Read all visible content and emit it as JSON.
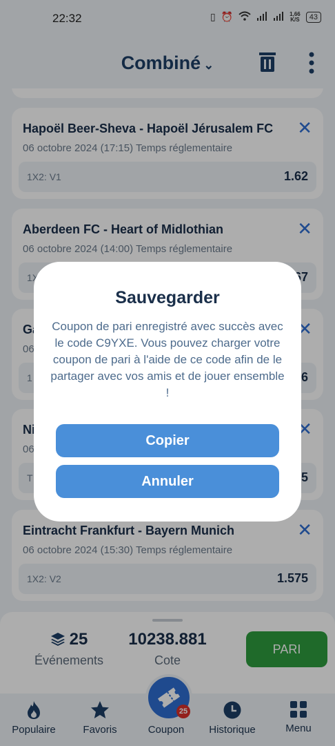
{
  "status_bar": {
    "time": "22:32",
    "speed_value": "1,66",
    "speed_unit": "K/S",
    "battery": "43"
  },
  "header": {
    "title": "Combiné"
  },
  "bets": [
    {
      "match": "Hapoël Beer-Sheva - Hapoël Jérusalem FC",
      "date": "06 octobre 2024 (17:15) Temps réglementaire",
      "selection": "1X2: V1",
      "odd": "1.62"
    },
    {
      "match": "Aberdeen FC - Heart of Midlothian",
      "date": "06 octobre 2024 (14:00) Temps réglementaire",
      "selection": "1X2: V1",
      "odd": "1.67"
    },
    {
      "match": "Ga",
      "date": "06",
      "selection": "1",
      "odd": "6"
    },
    {
      "match": "Ni",
      "date": "06",
      "selection": "T",
      "odd": "5"
    },
    {
      "match": "Eintracht Frankfurt - Bayern Munich",
      "date": "06 octobre 2024 (15:30) Temps réglementaire",
      "selection": "1X2: V2",
      "odd": "1.575"
    }
  ],
  "summary": {
    "events_count": "25",
    "events_label": "Événements",
    "odds_value": "10238.881",
    "odds_label": "Cote",
    "bet_button": "PARI"
  },
  "tabs": {
    "popular": "Populaire",
    "favorites": "Favoris",
    "coupon": "Coupon",
    "coupon_badge": "25",
    "history": "Historique",
    "menu": "Menu"
  },
  "dialog": {
    "title": "Sauvegarder",
    "message": "Coupon de pari enregistré avec succès avec le code C9YXE. Vous pouvez charger votre coupon de pari à l'aide de ce code afin de le partager avec vos amis et de jouer ensemble !",
    "copy_button": "Copier",
    "cancel_button": "Annuler"
  },
  "colors": {
    "accent": "#2f6ed1",
    "bet_button": "#2f9d3f",
    "dialog_button": "#4a8fd9",
    "badge": "#d9302a"
  }
}
